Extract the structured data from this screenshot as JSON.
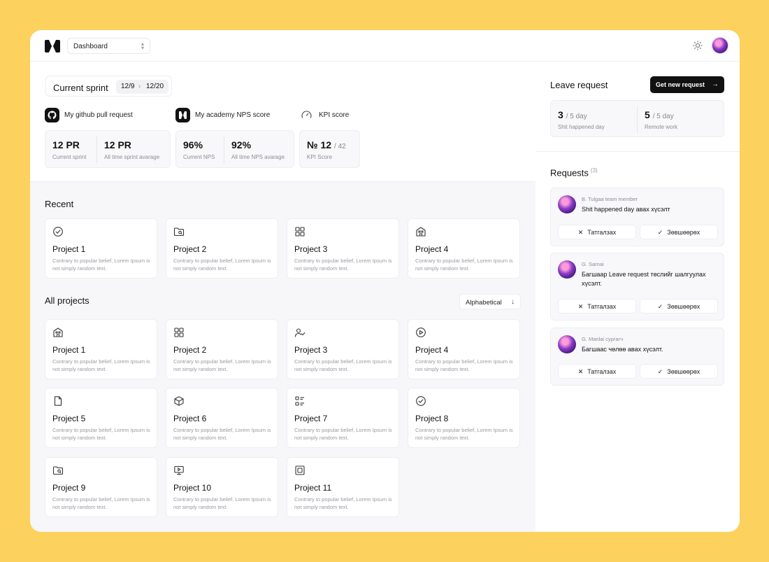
{
  "header": {
    "page_selector": "Dashboard"
  },
  "sprint": {
    "label": "Current sprint",
    "start": "12/9",
    "end": "12/20"
  },
  "metrics": {
    "github": {
      "label": "My github pull request",
      "items": [
        {
          "value": "12 PR",
          "sub": "Current sprint"
        },
        {
          "value": "12 PR",
          "sub": "All time sprint avarage"
        }
      ]
    },
    "nps": {
      "label": "My academy NPS score",
      "items": [
        {
          "value": "96%",
          "sub": "Current NPS"
        },
        {
          "value": "92%",
          "sub": "All time NPS avarage"
        }
      ]
    },
    "kpi": {
      "label": "KPI score",
      "value": "№ 12",
      "total": "/ 42",
      "sub": "KPI Score"
    }
  },
  "recent": {
    "title": "Recent",
    "cards": [
      {
        "title": "Project 1",
        "desc": "Contrary to popular belief, Lorem Ipsum is not simply random text.",
        "icon": "check-circle-icon"
      },
      {
        "title": "Project 2",
        "desc": "Contrary to popular belief, Lorem Ipsum is not simply random text.",
        "icon": "folder-search-icon"
      },
      {
        "title": "Project 3",
        "desc": "Contrary to popular belief, Lorem Ipsum is not simply random text.",
        "icon": "grid-icon"
      },
      {
        "title": "Project 4",
        "desc": "Contrary to popular belief, Lorem Ipsum is not simply random text.",
        "icon": "building-icon"
      }
    ]
  },
  "all_projects": {
    "title": "All projects",
    "sort_label": "Alphabetical",
    "cards": [
      {
        "title": "Project 1",
        "desc": "Contrary to popular belief, Lorem Ipsum is not simply random text.",
        "icon": "building-icon"
      },
      {
        "title": "Project 2",
        "desc": "Contrary to popular belief, Lorem Ipsum is not simply random text.",
        "icon": "grid-icon"
      },
      {
        "title": "Project 3",
        "desc": "Contrary to popular belief, Lorem Ipsum is not simply random text.",
        "icon": "user-check-icon"
      },
      {
        "title": "Project 4",
        "desc": "Contrary to popular belief, Lorem Ipsum is not simply random text.",
        "icon": "play-circle-icon"
      },
      {
        "title": "Project 5",
        "desc": "Contrary to popular belief, Lorem Ipsum is not simply random text.",
        "icon": "file-icon"
      },
      {
        "title": "Project 6",
        "desc": "Contrary to popular belief, Lorem Ipsum is not simply random text.",
        "icon": "box-icon"
      },
      {
        "title": "Project 7",
        "desc": "Contrary to popular belief, Lorem Ipsum is not simply random text.",
        "icon": "list-icon"
      },
      {
        "title": "Project 8",
        "desc": "Contrary to popular belief, Lorem Ipsum is not simply random text.",
        "icon": "check-circle-icon"
      },
      {
        "title": "Project 9",
        "desc": "Contrary to popular belief, Lorem Ipsum is not simply random text.",
        "icon": "folder-search-icon"
      },
      {
        "title": "Project 10",
        "desc": "Contrary to popular belief, Lorem Ipsum is not simply random text.",
        "icon": "monitor-play-icon"
      },
      {
        "title": "Project 11",
        "desc": "Contrary to popular belief, Lorem Ipsum is not simply random text.",
        "icon": "square-icon"
      }
    ]
  },
  "leave": {
    "title": "Leave request",
    "button": "Get new request",
    "items": [
      {
        "value": "3",
        "total": "/ 5 day",
        "sub": "Shit happened day"
      },
      {
        "value": "5",
        "total": "/ 5 day",
        "sub": "Remote work"
      }
    ]
  },
  "requests": {
    "title": "Requests",
    "count": "(3)",
    "reject_label": "Татгалзах",
    "approve_label": "Зөвшөөрөх",
    "items": [
      {
        "who": "B. Tulgaa team member",
        "msg": "Shit happened day авах хүсэлт"
      },
      {
        "who": "G. Sarnai",
        "msg": "Багшаар Leave request төслийг шалгуулах хүсэлт."
      },
      {
        "who": "G. Manlai сургагч",
        "msg": "Багшаас чөлөө авах хүсэлт."
      }
    ]
  }
}
